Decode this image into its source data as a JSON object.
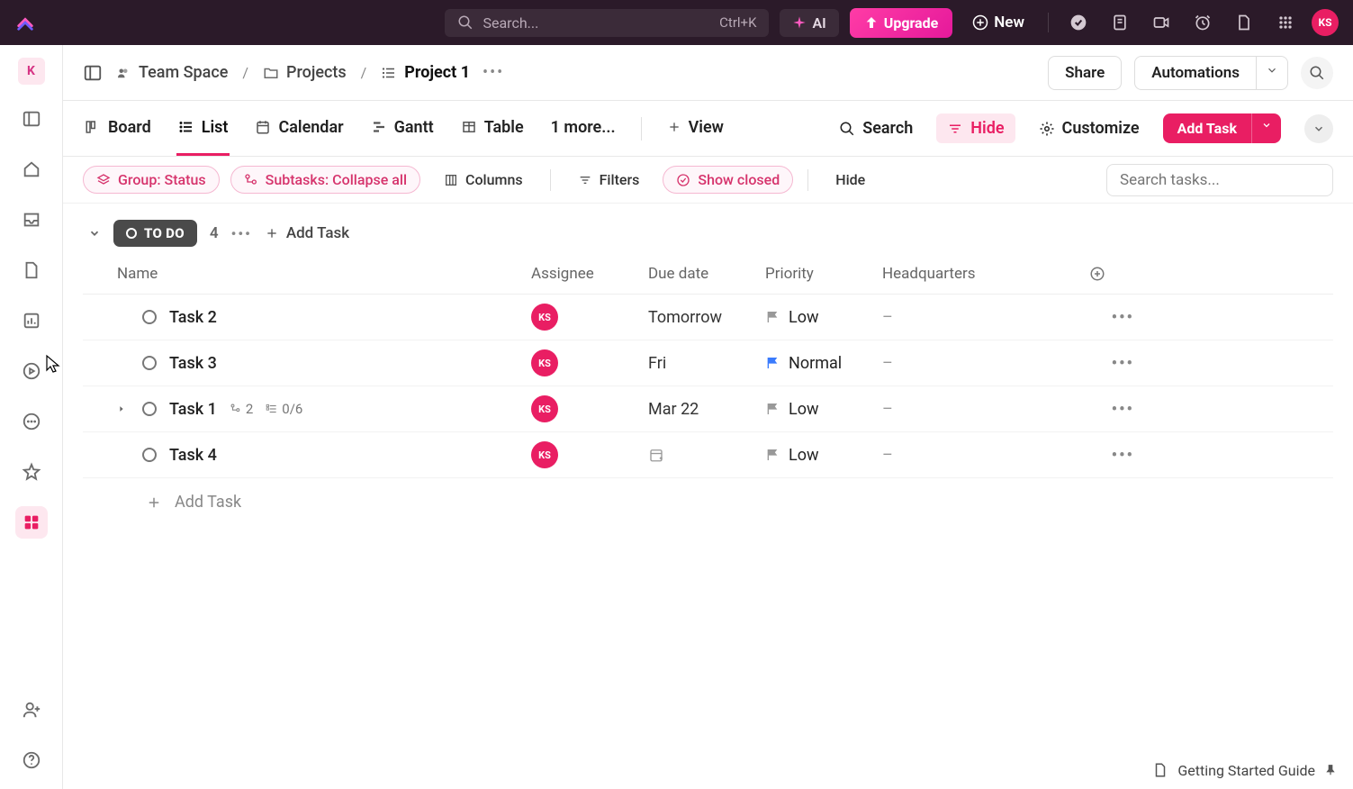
{
  "topbar": {
    "search_placeholder": "Search...",
    "search_shortcut": "Ctrl+K",
    "ai_label": "AI",
    "upgrade_label": "Upgrade",
    "new_label": "New",
    "avatar": "KS"
  },
  "rail": {
    "avatar": "K"
  },
  "breadcrumb": {
    "space": "Team Space",
    "folder": "Projects",
    "list": "Project 1",
    "share": "Share",
    "automations": "Automations"
  },
  "views": {
    "tabs": [
      "Board",
      "List",
      "Calendar",
      "Gantt",
      "Table"
    ],
    "more": "1 more...",
    "add_view": "View",
    "active": "List",
    "search": "Search",
    "hide": "Hide",
    "customize": "Customize",
    "add_task": "Add Task"
  },
  "filters": {
    "group": "Group: Status",
    "subtasks": "Subtasks: Collapse all",
    "columns": "Columns",
    "filters": "Filters",
    "show_closed": "Show closed",
    "hide": "Hide",
    "search_placeholder": "Search tasks..."
  },
  "group": {
    "status": "TO DO",
    "count": "4",
    "add_task": "Add Task"
  },
  "columns": {
    "name": "Name",
    "assignee": "Assignee",
    "due": "Due date",
    "priority": "Priority",
    "hq": "Headquarters"
  },
  "tasks": [
    {
      "name": "Task 2",
      "assignee": "KS",
      "due": "Tomorrow",
      "priority": "Low",
      "priority_color": "grey",
      "hq": "–",
      "expandable": false
    },
    {
      "name": "Task 3",
      "assignee": "KS",
      "due": "Fri",
      "priority": "Normal",
      "priority_color": "blue",
      "hq": "–",
      "expandable": false
    },
    {
      "name": "Task 1",
      "assignee": "KS",
      "due": "Mar 22",
      "priority": "Low",
      "priority_color": "grey",
      "hq": "–",
      "expandable": true,
      "sub_count": "2",
      "checklist": "0/6"
    },
    {
      "name": "Task 4",
      "assignee": "KS",
      "due": "",
      "priority": "Low",
      "priority_color": "grey",
      "hq": "–",
      "expandable": false
    }
  ],
  "add_row": "Add Task",
  "footer": {
    "guide": "Getting Started Guide"
  }
}
